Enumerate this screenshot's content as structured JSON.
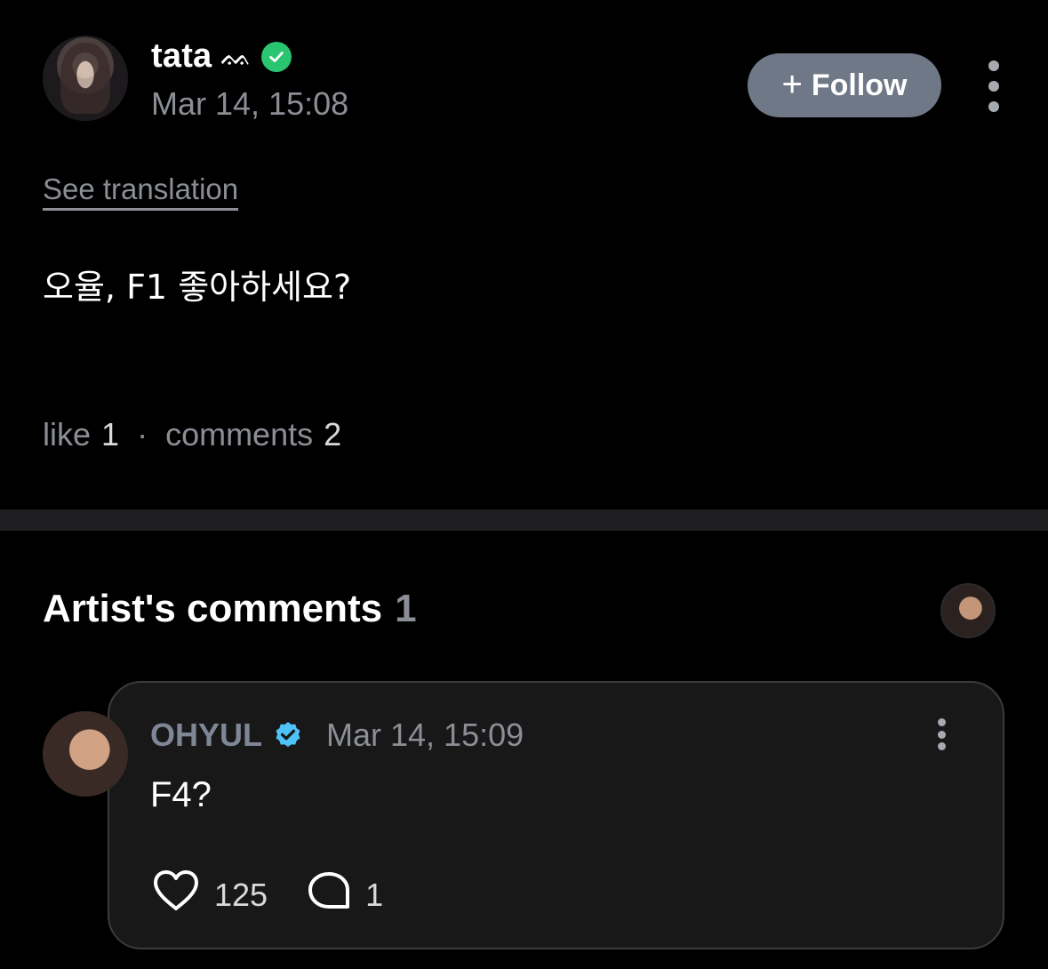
{
  "post": {
    "author_name": "tata",
    "author_decoration": "ᨐ",
    "verified_icon": "green-check-badge",
    "date": "Mar 14, 15:08",
    "follow_label": "Follow",
    "see_translation_label": "See translation",
    "text": "오율, F1 좋아하세요?",
    "like_label": "like",
    "like_count": "1",
    "separator": "·",
    "comments_label": "comments",
    "comments_count": "2"
  },
  "artist_comments": {
    "title": "Artist's comments",
    "count": "1"
  },
  "comment": {
    "author": "OHYUL",
    "verified_icon": "blue-check-badge",
    "date": "Mar 14, 15:09",
    "text": "F4?",
    "like_count": "125",
    "reply_count": "1"
  },
  "colors": {
    "background": "#000000",
    "follow_button": "#6f7886",
    "muted_text": "#8b8e95",
    "green_badge": "#29c571",
    "blue_badge": "#4fc3f7",
    "card_background": "#181819"
  }
}
